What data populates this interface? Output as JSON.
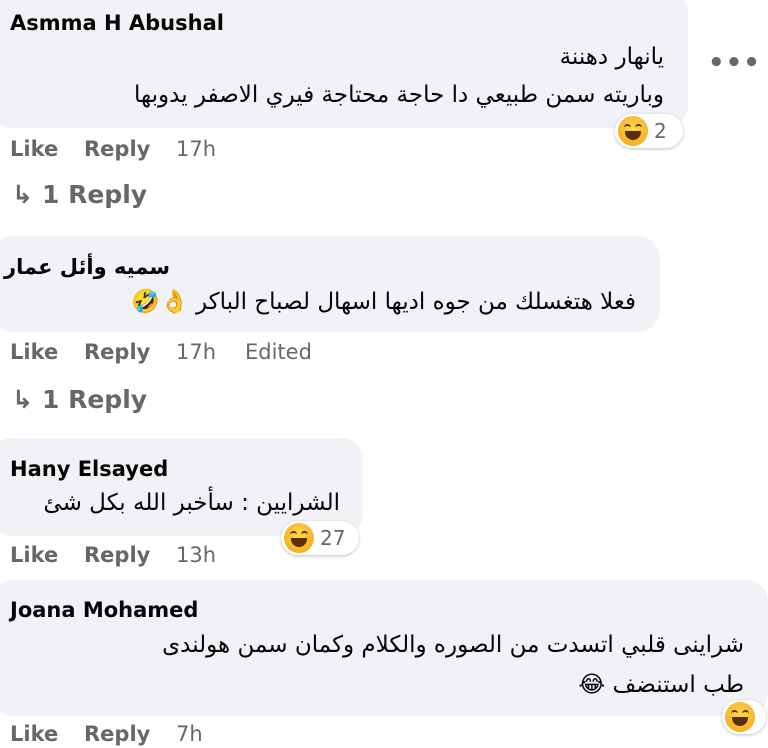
{
  "comments": [
    {
      "author": "Asmma H Abushal",
      "lines": [
        "يانهار دهننة",
        "وباريته سمن طبيعي دا حاجة محتاجة فيري الاصفر يدوبها"
      ],
      "like": "Like",
      "reply": "Reply",
      "time": "17h",
      "reaction_count": "2",
      "replies_label": "1 Reply",
      "reaction_icon": "laugh-emoji"
    },
    {
      "author": "سميه وأئل عمار",
      "lines": [
        "فعلا هتغسلك من جوه اديها اسهال لصباح الباكر 👌🤣"
      ],
      "like": "Like",
      "reply": "Reply",
      "time": "17h",
      "edited": "Edited",
      "replies_label": "1 Reply"
    },
    {
      "author": "Hany Elsayed",
      "lines": [
        "الشرايين : سأخبر الله بكل شئ"
      ],
      "like": "Like",
      "reply": "Reply",
      "time": "13h",
      "reaction_count": "27",
      "reaction_icon": "laugh-emoji"
    },
    {
      "author": "Joana Mohamed",
      "lines": [
        "شراينى قلبي اتسدت من الصوره والكلام وكمان سمن هولندى",
        "طب استنضف 😂"
      ],
      "like": "Like",
      "reply": "Reply",
      "time": "7h",
      "reaction_icon": "laugh-emoji"
    }
  ],
  "more_options_icon": "more-options-icon",
  "reply_arrow_icon": "reply-arrow-icon",
  "colors": {
    "bubble": "#f0f2f5",
    "meta": "#65676b",
    "text": "#050505"
  }
}
